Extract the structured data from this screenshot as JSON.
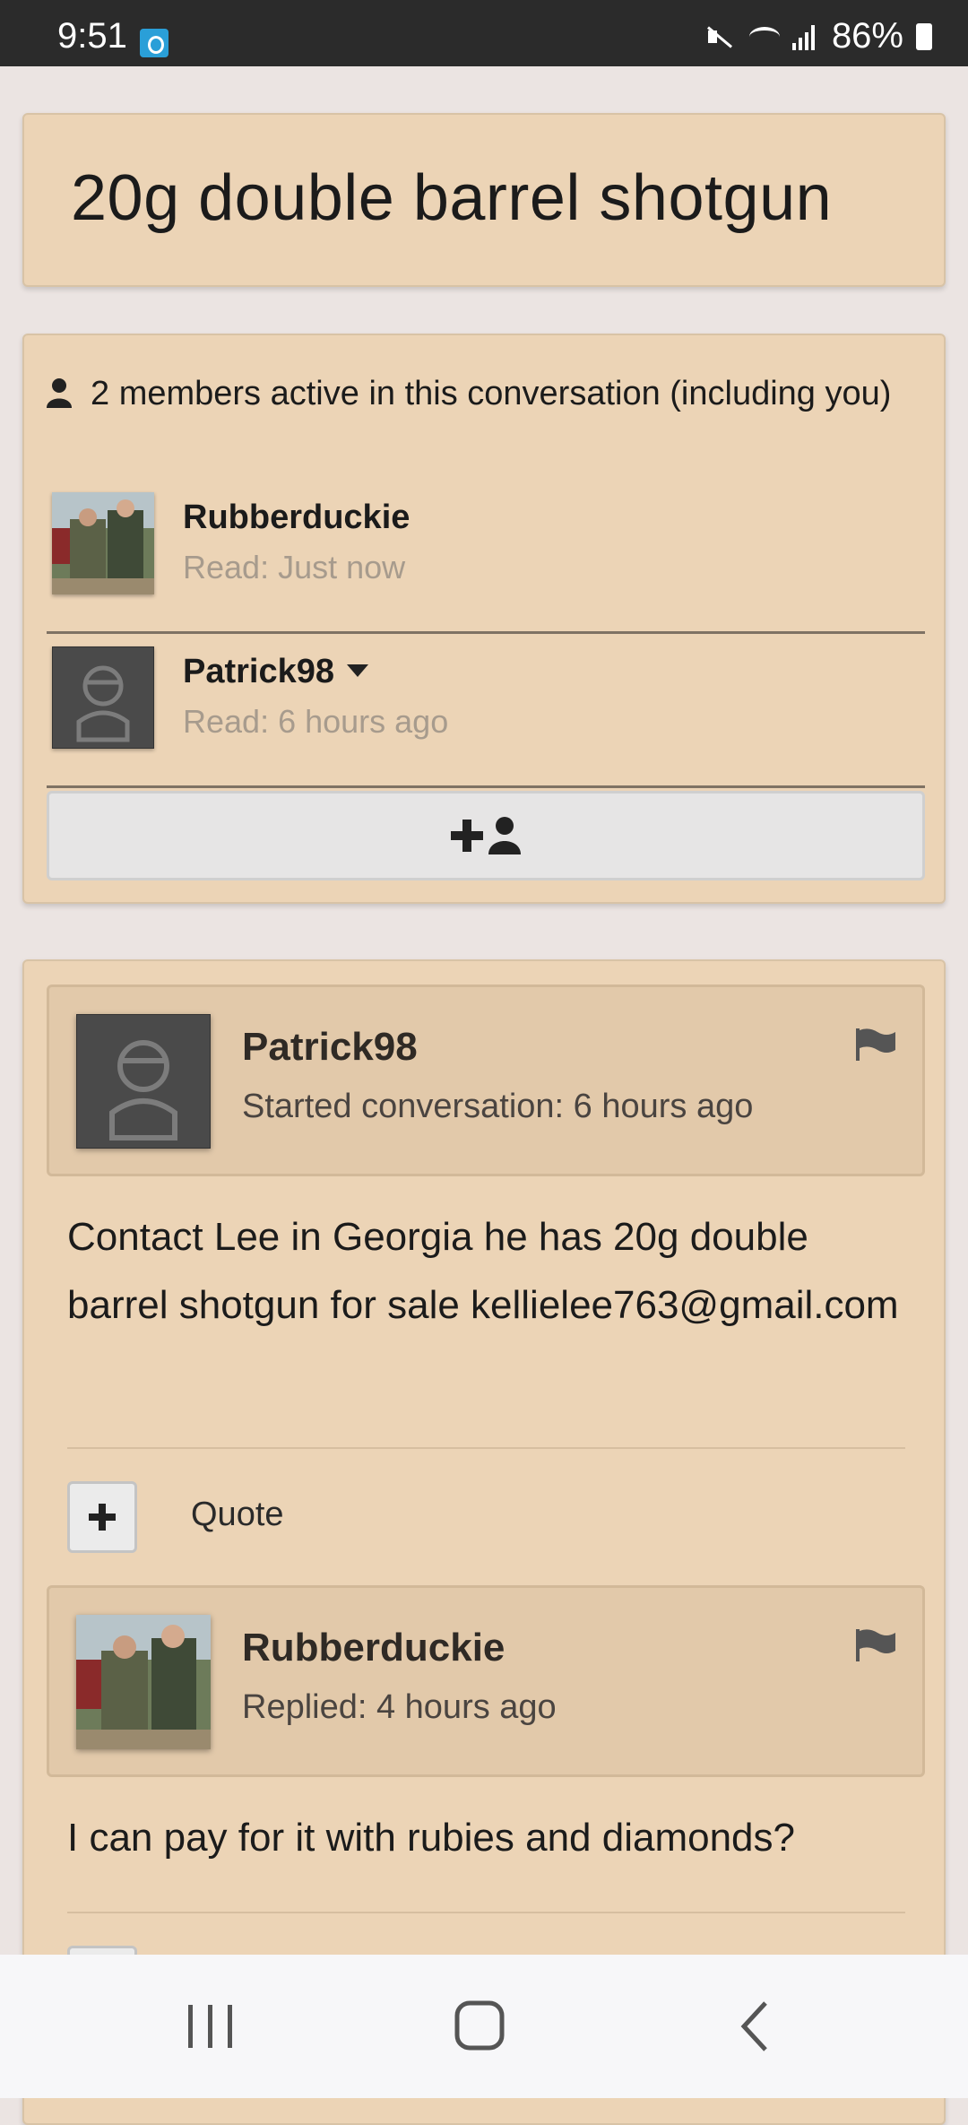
{
  "status_bar": {
    "time": "9:51",
    "battery": "86%"
  },
  "title": "20g double barrel shotgun",
  "members": {
    "summary": "2 members active in this conversation (including you)",
    "list": [
      {
        "name": "Rubberduckie",
        "read": "Read: Just now"
      },
      {
        "name": "Patrick98",
        "read": "Read: 6 hours ago"
      }
    ]
  },
  "posts": [
    {
      "author": "Patrick98",
      "meta": "Started conversation: 6 hours ago",
      "body": "Contact Lee in Georgia he has 20g double barrel shotgun for sale kellielee763@gmail.com",
      "quote_label": "Quote"
    },
    {
      "author": "Rubberduckie",
      "meta": "Replied: 4 hours ago",
      "body": "I can pay for it with rubies and diamonds?"
    }
  ]
}
